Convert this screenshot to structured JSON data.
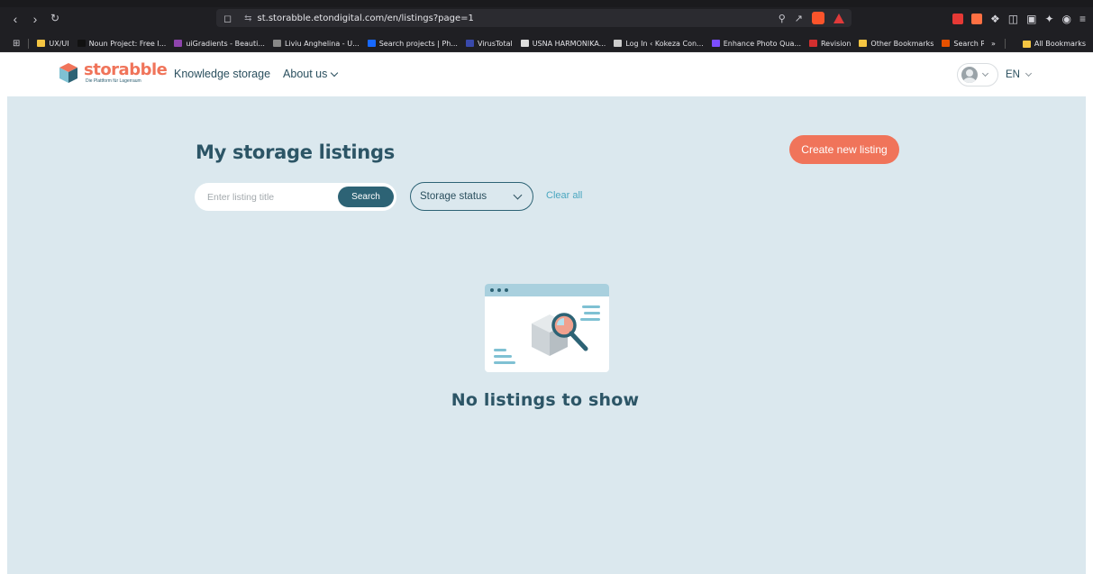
{
  "browser": {
    "url": "st.storabble.etondigital.com/en/listings?page=1",
    "bookmarks": [
      {
        "label": "UX/UI",
        "color": "#f5c542"
      },
      {
        "label": "Noun Project: Free I...",
        "color": "#111111"
      },
      {
        "label": "uiGradients - Beauti...",
        "color": "#8e44ad"
      },
      {
        "label": "Liviu Anghelina - U...",
        "color": "#888888"
      },
      {
        "label": "Search projects | Ph...",
        "color": "#1769ff"
      },
      {
        "label": "VirusTotal",
        "color": "#3949ab"
      },
      {
        "label": "USNA HARMONIKA...",
        "color": "#dddddd"
      },
      {
        "label": "Log In ‹ Kokeza Con...",
        "color": "#cccccc"
      },
      {
        "label": "Enhance Photo Qua...",
        "color": "#7c4dff"
      },
      {
        "label": "Revision",
        "color": "#d32f2f"
      },
      {
        "label": "Other Bookmarks",
        "color": "#f5c542"
      },
      {
        "label": "Search Results for \"s...",
        "color": "#e65100"
      }
    ],
    "all_bookmarks": "All Bookmarks",
    "more": "»"
  },
  "header": {
    "logo_text": "storabble",
    "logo_sub": "Die Plattform für Lagerraum",
    "nav": {
      "knowledge": "Knowledge storage",
      "about": "About us"
    },
    "lang": "EN"
  },
  "main": {
    "title": "My storage listings",
    "create_label": "Create new listing",
    "search_placeholder": "Enter listing title",
    "search_label": "Search",
    "status_label": "Storage status",
    "clear_label": "Clear all",
    "empty_text": "No listings to show"
  },
  "colors": {
    "accent": "#f0745a",
    "primary": "#2d6375",
    "background": "#dbe8ee"
  }
}
